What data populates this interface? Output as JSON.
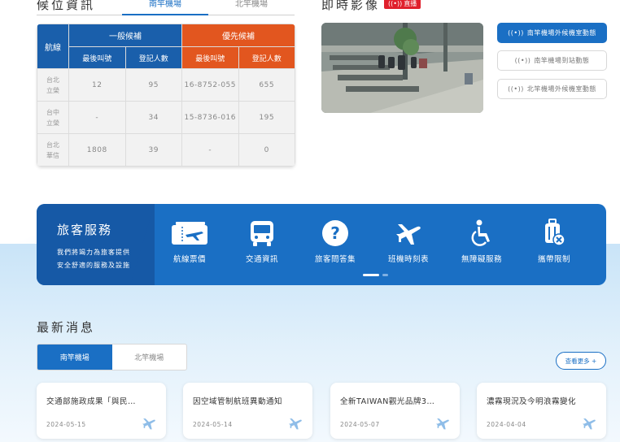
{
  "waitlist": {
    "title": "候位資訊",
    "tabs": [
      "南竿機場",
      "北竿機場"
    ],
    "active_tab": 0,
    "headers": {
      "route": "航線",
      "normal": "一般候補",
      "priority": "優先候補",
      "last_call": "最後叫號",
      "registered": "登記人數"
    },
    "rows": [
      {
        "route_line1": "台北",
        "route_line2": "立榮",
        "normal_last": "12",
        "normal_count": "95",
        "priority_last": "16-8752-055",
        "priority_count": "655"
      },
      {
        "route_line1": "台中",
        "route_line2": "立榮",
        "normal_last": "-",
        "normal_count": "34",
        "priority_last": "15-8736-016",
        "priority_count": "195"
      },
      {
        "route_line1": "台北",
        "route_line2": "華信",
        "normal_last": "1808",
        "normal_count": "39",
        "priority_last": "-",
        "priority_count": "0"
      }
    ]
  },
  "live": {
    "title": "即時影像",
    "badge": "直播",
    "cameras": [
      {
        "label": "南竿機場外候機室動態",
        "active": true
      },
      {
        "label": "南竿機場到站動態",
        "active": false
      },
      {
        "label": "北竿機場外候機室動態",
        "active": false
      }
    ]
  },
  "services": {
    "title": "旅客服務",
    "desc_line1": "我們將竭力為旅客提供",
    "desc_line2": "安全舒適的服務及設施",
    "items": [
      {
        "label": "航線票價",
        "icon": "ticket-icon"
      },
      {
        "label": "交通資訊",
        "icon": "bus-icon"
      },
      {
        "label": "旅客問答集",
        "icon": "question-icon"
      },
      {
        "label": "班機時刻表",
        "icon": "airplane-icon"
      },
      {
        "label": "無障礙服務",
        "icon": "wheelchair-icon"
      },
      {
        "label": "攜帶限制",
        "icon": "luggage-restrict-icon"
      }
    ]
  },
  "news": {
    "title": "最新消息",
    "tabs": [
      "南竿機場",
      "北竿機場"
    ],
    "more_label": "查看更多 +",
    "cards": [
      {
        "title": "交通部施政成果「與民…",
        "date": "2024-05-15"
      },
      {
        "title": "因空域管制航班異動通知",
        "date": "2024-05-14"
      },
      {
        "title": "全新TAIWAN觀光品牌3…",
        "date": "2024-05-07"
      },
      {
        "title": "濃霧現況及今明浪霧變化",
        "date": "2024-04-04"
      }
    ]
  },
  "colors": {
    "brand_blue": "#1a6fc4",
    "dark_blue": "#1a5fab",
    "priority_orange": "#e2561f",
    "live_red": "#e0202c"
  }
}
